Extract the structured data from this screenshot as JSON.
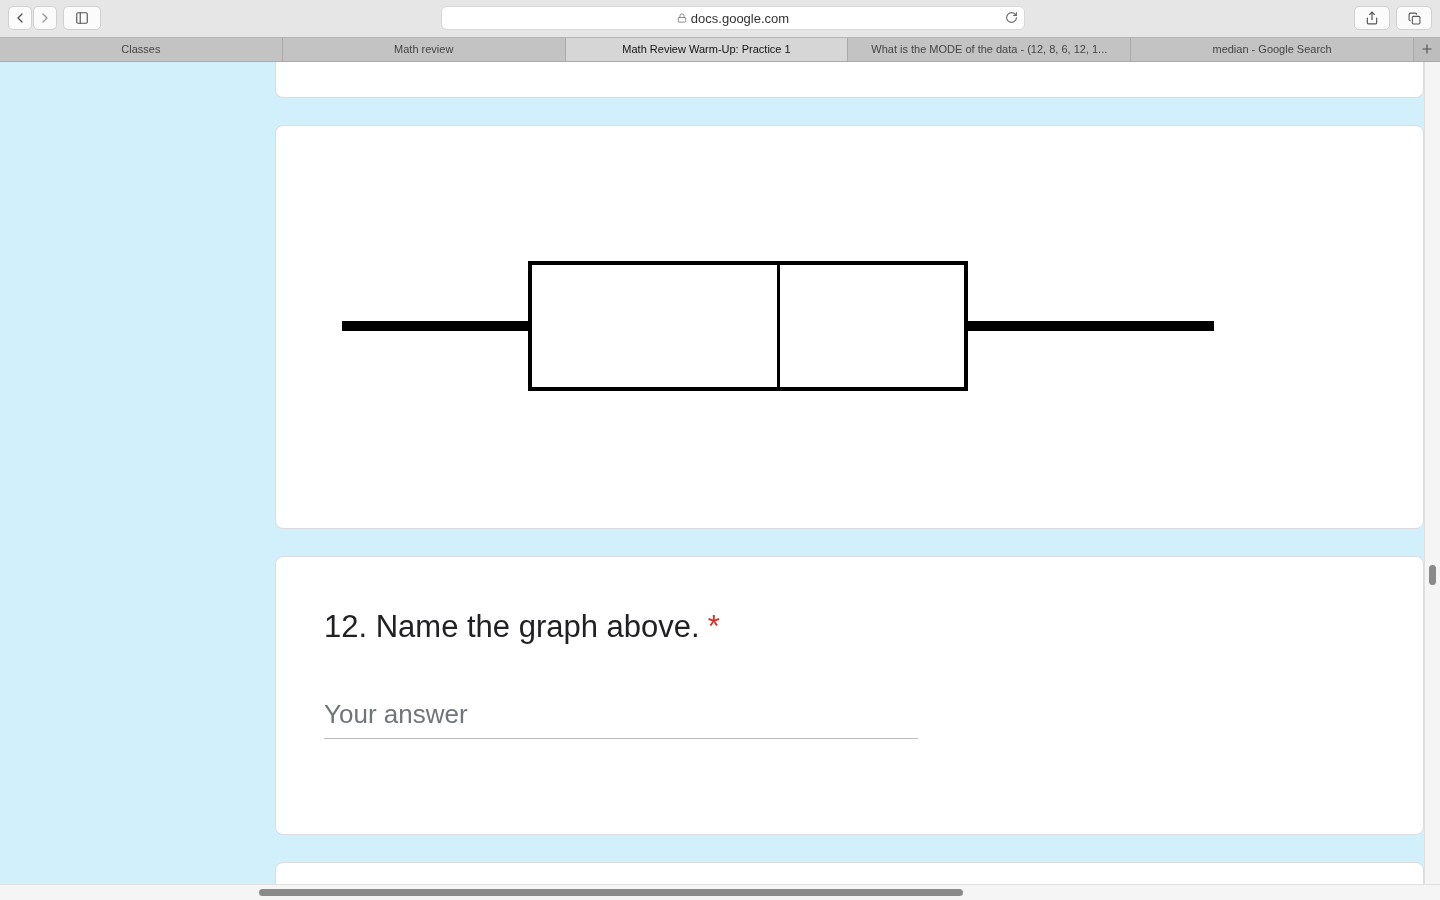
{
  "browser": {
    "url": "docs.google.com",
    "tabs": [
      {
        "title": "Classes",
        "selected": false
      },
      {
        "title": "Math review",
        "selected": false
      },
      {
        "title": "Math Review Warm-Up: Practice 1",
        "selected": true
      },
      {
        "title": "What is the MODE of the data - (12, 8, 6, 12, 1...",
        "selected": false
      },
      {
        "title": "median - Google Search",
        "selected": false
      }
    ]
  },
  "form": {
    "question": {
      "title": "12. Name the graph above.",
      "required": true,
      "required_mark": "*",
      "answer": {
        "placeholder": "Your answer"
      }
    }
  }
}
